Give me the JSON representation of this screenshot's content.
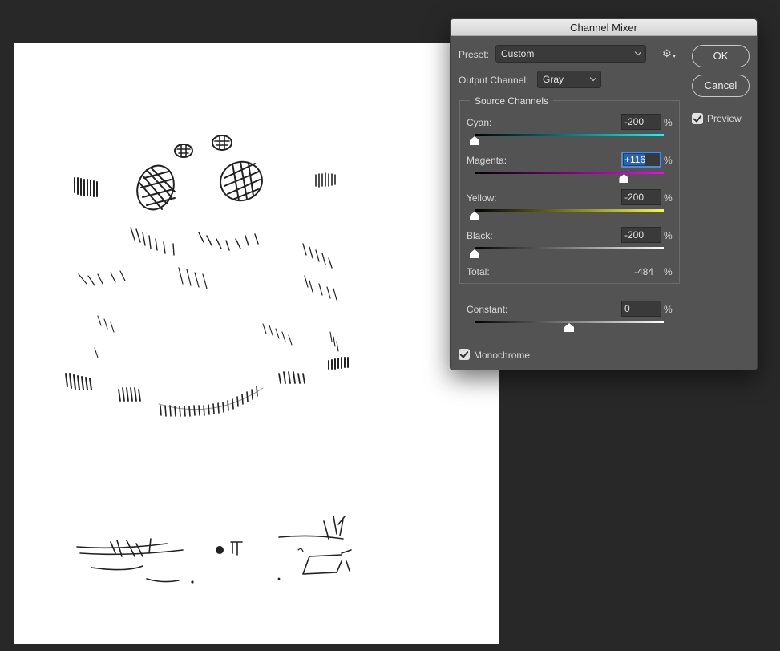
{
  "dialog": {
    "title": "Channel Mixer",
    "preset_label": "Preset:",
    "preset_value": "Custom",
    "output_label": "Output Channel:",
    "output_value": "Gray",
    "gear_icon": "gear-icon",
    "ok_label": "OK",
    "cancel_label": "Cancel",
    "preview_label": "Preview",
    "preview_checked": true,
    "source_title": "Source Channels",
    "percent": "%",
    "channels": [
      {
        "label": "Cyan:",
        "value": "-200",
        "gradient_from": "#000000",
        "gradient_to": "#00ffff",
        "fraction": 0.0
      },
      {
        "label": "Magenta:",
        "value": "+116",
        "gradient_from": "#000000",
        "gradient_to": "#ff00ff",
        "fraction": 0.79
      },
      {
        "label": "Yellow:",
        "value": "-200",
        "gradient_from": "#000000",
        "gradient_to": "#ffff00",
        "fraction": 0.0
      },
      {
        "label": "Black:",
        "value": "-200",
        "gradient_from": "#000000",
        "gradient_to": "#ffffff",
        "fraction": 0.0
      }
    ],
    "total_label": "Total:",
    "total_value": "-484",
    "constant_label": "Constant:",
    "constant_value": "0",
    "constant_fraction": 0.5,
    "monochrome_label": "Monochrome",
    "monochrome_checked": true
  },
  "colors": {
    "workspace": "#282828",
    "dialog_bg": "#535353",
    "focus_accent": "#4f8cd5"
  }
}
